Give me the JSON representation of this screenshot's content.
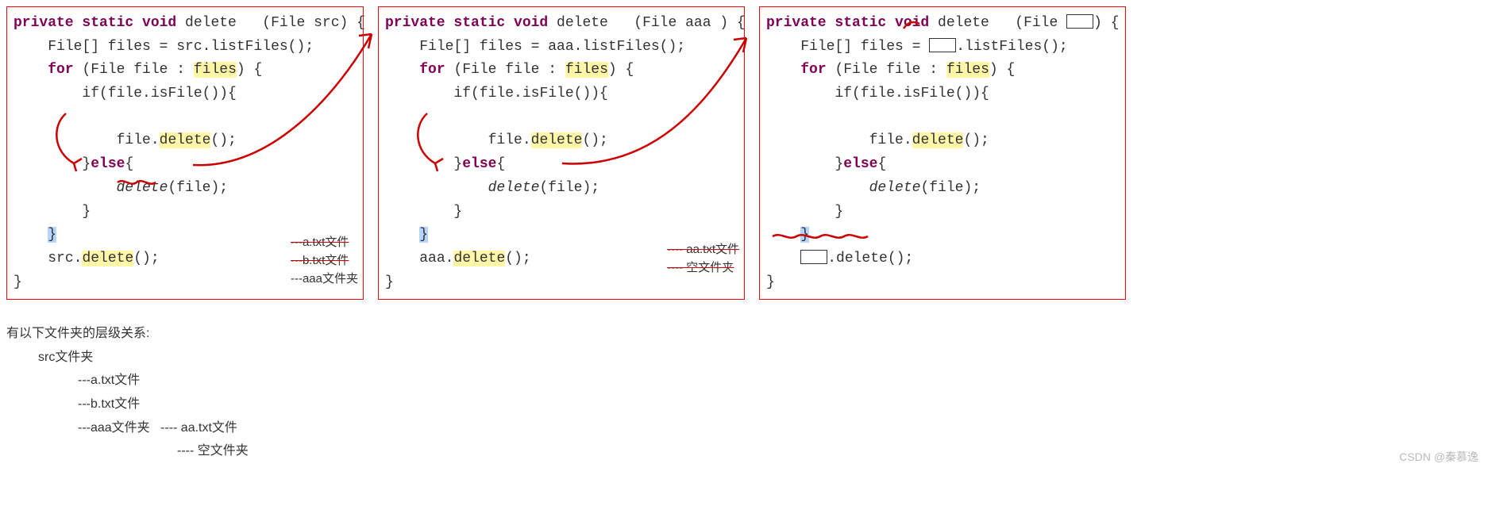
{
  "code1": {
    "kw_sig": "private static void",
    "method": "delete",
    "param_type": "File",
    "param_name": "src",
    "line_files": "File[] files = src.listFiles();",
    "kw_for": "for",
    "for_body": "(File file :",
    "for_var": "files",
    "for_close": ") {",
    "if_line": "if(file.isFile()){",
    "file_delete_pre": "file.",
    "file_delete_call": "delete",
    "file_delete_post": "();",
    "else_brace": "}",
    "kw_else": "else",
    "else_open": "{",
    "recursive_call": "delete",
    "recursive_arg": "(file);",
    "close_inner": "}",
    "close_for": "}",
    "src_delete_pre": "src.",
    "src_delete_call": "delete",
    "src_delete_post": "();",
    "close_method": "}",
    "notes": {
      "n1": "---a.txt文件",
      "n2": "---b.txt文件",
      "n3": "---aaa文件夹"
    }
  },
  "code2": {
    "kw_sig": "private static void",
    "method": "delete",
    "param_type": "File",
    "param_name": "aaa",
    "param_close": ") {",
    "line_files": "File[] files = aaa.listFiles();",
    "kw_for": "for",
    "for_body": "(File file :",
    "for_var": "files",
    "for_close": ") {",
    "if_line": "if(file.isFile()){",
    "file_delete_pre": "file.",
    "file_delete_call": "delete",
    "file_delete_post": "();",
    "else_brace": "}",
    "kw_else": "else",
    "else_open": "{",
    "recursive_call": "delete",
    "recursive_arg": "(file);",
    "close_inner": "}",
    "close_for": "}",
    "src_delete_pre": "aaa.",
    "src_delete_call": "delete",
    "src_delete_post": "();",
    "close_method": "}",
    "notes": {
      "n1": "---- aa.txt文件",
      "n2": "---- 空文件夹"
    }
  },
  "code3": {
    "kw_sig": "private static void",
    "method": "delete",
    "param_type": "File",
    "param_close": ") {",
    "line_files_a": "File[] files = ",
    "line_files_b": ".listFiles();",
    "kw_for": "for",
    "for_body": "(File file :",
    "for_var": "files",
    "for_close": ") {",
    "if_line": "if(file.isFile()){",
    "file_delete_pre": "file.",
    "file_delete_call": "delete",
    "file_delete_post": "();",
    "else_brace": "}",
    "kw_else": "else",
    "else_open": "{",
    "recursive_call": "delete",
    "recursive_arg": "(file);",
    "close_inner": "}",
    "close_for": "}",
    "src_delete_post": ".delete();",
    "close_method": "}"
  },
  "lower": {
    "title": "有以下文件夹的层级关系:",
    "l1": "src文件夹",
    "l2": "---a.txt文件",
    "l3": "---b.txt文件",
    "l4a": "---aaa文件夹",
    "l4b": "---- aa.txt文件",
    "l5": "---- 空文件夹"
  },
  "watermark": "CSDN @秦慕逸"
}
